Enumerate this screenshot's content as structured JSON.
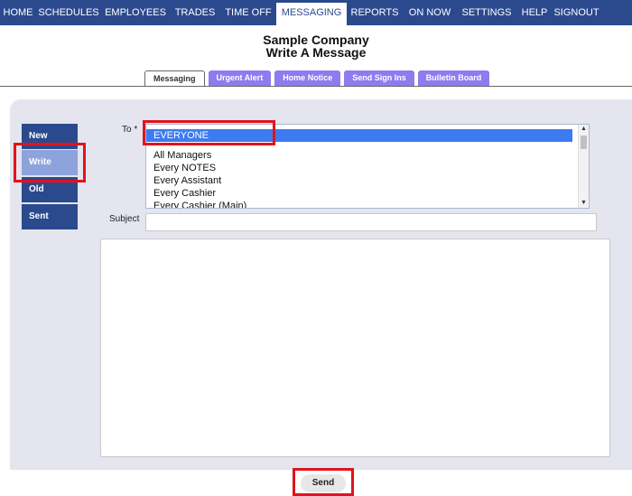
{
  "nav": {
    "items": [
      {
        "label": "HOME",
        "w": 40
      },
      {
        "label": "SCHEDULES",
        "w": 72
      },
      {
        "label": "EMPLOYEES",
        "w": 76
      },
      {
        "label": "TRADES",
        "w": 56
      },
      {
        "label": "TIME OFF",
        "w": 62
      },
      {
        "label": "MESSAGING",
        "w": 78
      },
      {
        "label": "REPORTS",
        "w": 62
      },
      {
        "label": "ON NOW",
        "w": 60
      },
      {
        "label": "SETTINGS",
        "w": 66
      },
      {
        "label": "HELP",
        "w": 40
      },
      {
        "label": "SIGNOUT",
        "w": 53
      }
    ],
    "active_index": 5
  },
  "header": {
    "company": "Sample Company",
    "title": "Write A Message"
  },
  "subtabs": [
    "Messaging",
    "Urgent Alert",
    "Home Notice",
    "Send Sign Ins",
    "Bulletin Board"
  ],
  "side": {
    "new_label": "New",
    "write_label": "Write",
    "old_label": "Old",
    "sent_label": "Sent"
  },
  "form": {
    "to_label": "To *",
    "recipients": {
      "selected": "EVERYONE",
      "separator": "---------------",
      "options": [
        "All Managers",
        "Every NOTES",
        "Every Assistant",
        "Every Cashier",
        "Every Cashier (Main)"
      ]
    },
    "subject_label": "Subject",
    "subject_value": "",
    "body_value": "",
    "send_label": "Send"
  },
  "colors": {
    "nav_bg": "#2b4a8e",
    "tab_purple": "#8c7cf0",
    "highlight_red": "#e0141b",
    "selected_blue": "#3d7bf0"
  }
}
